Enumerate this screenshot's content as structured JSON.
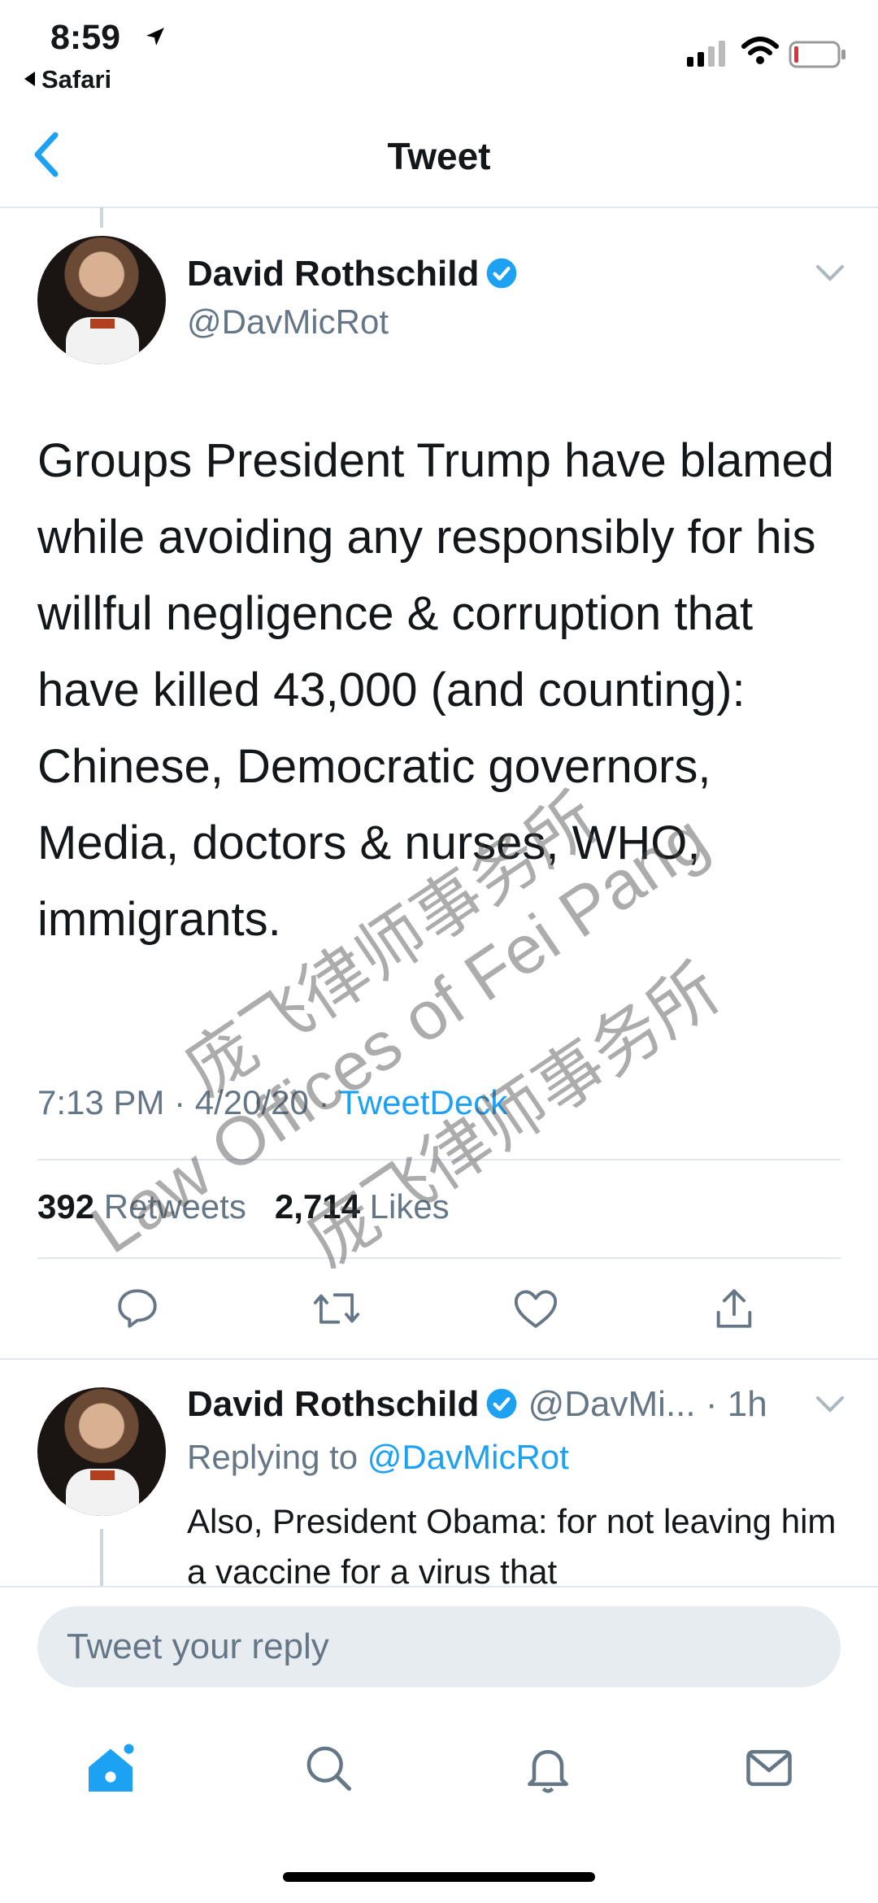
{
  "status_bar": {
    "time": "8:59",
    "back_app": "Safari"
  },
  "nav": {
    "title": "Tweet"
  },
  "tweet": {
    "author_name": "David Rothschild",
    "author_handle": "@DavMicRot",
    "text": "Groups President Trump have blamed while avoiding any responsibly for his willful negligence & corruption that have killed 43,000 (and counting): Chinese, Democratic governors, Media, doctors & nurses, WHO, immigrants.",
    "time": "7:13 PM",
    "date": "4/20/20",
    "source": "TweetDeck",
    "separator": " · ",
    "retweets_count": "392",
    "retweets_label": "Retweets",
    "likes_count": "2,714",
    "likes_label": "Likes"
  },
  "reply": {
    "author_name": "David Rothschild",
    "author_handle_truncated": "@DavMi...",
    "age": "· 1h",
    "replying_prefix": "Replying to",
    "replying_handle": "@DavMicRot",
    "text": "Also, President Obama: for not leaving him a vaccine for a virus that"
  },
  "compose": {
    "placeholder": "Tweet your reply"
  },
  "watermark": {
    "line1": "庞飞律师事务所",
    "line2": "Law Offices of Fei Pang",
    "line3": "庞飞律师事务所"
  },
  "colors": {
    "accent": "#1da1f2",
    "secondary_text": "#657786",
    "divider": "#e1e8ed"
  },
  "icons": {
    "action_row": [
      "reply-icon",
      "retweet-icon",
      "like-icon",
      "share-icon"
    ],
    "tab_bar": [
      "home-icon",
      "search-icon",
      "notifications-icon",
      "messages-icon"
    ]
  }
}
